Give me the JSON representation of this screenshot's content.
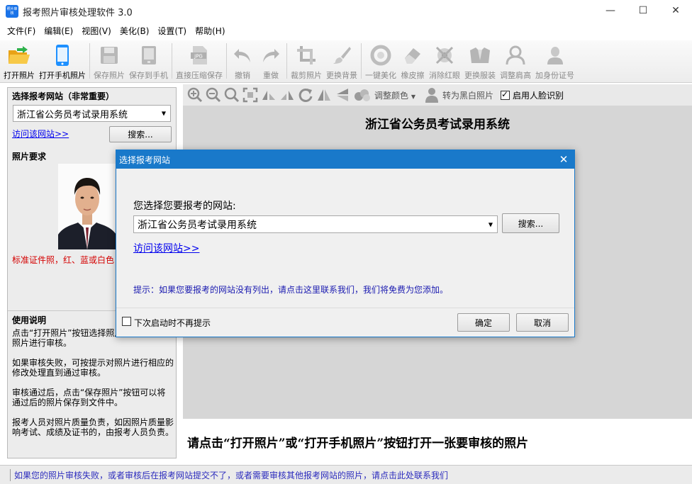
{
  "window": {
    "title": "报考照片审核处理软件 3.0",
    "app_icon_text": "照片审核",
    "minimize": "—",
    "maximize": "☐",
    "close": "✕"
  },
  "menu": [
    "文件(F)",
    "编辑(E)",
    "视图(V)",
    "美化(B)",
    "设置(T)",
    "帮助(H)"
  ],
  "toolbar": [
    {
      "label": "打开照片",
      "icon": "folder-open-icon",
      "enabled": true
    },
    {
      "label": "打开手机照片",
      "icon": "phone-icon",
      "enabled": true
    },
    {
      "label": "保存照片",
      "icon": "save-icon",
      "enabled": false
    },
    {
      "label": "保存到手机",
      "icon": "save-to-phone-icon",
      "enabled": false
    },
    {
      "label": "直接压缩保存",
      "icon": "jpg-compress-icon",
      "enabled": false
    },
    {
      "label": "撤销",
      "icon": "undo-icon",
      "enabled": false
    },
    {
      "label": "重做",
      "icon": "redo-icon",
      "enabled": false
    },
    {
      "label": "裁剪照片",
      "icon": "crop-icon",
      "enabled": false
    },
    {
      "label": "更换背景",
      "icon": "brush-icon",
      "enabled": false
    },
    {
      "label": "一键美化",
      "icon": "beautify-icon",
      "enabled": false
    },
    {
      "label": "橡皮擦",
      "icon": "eraser-icon",
      "enabled": false
    },
    {
      "label": "消除红眼",
      "icon": "red-eye-icon",
      "enabled": false
    },
    {
      "label": "更换服装",
      "icon": "clothes-icon",
      "enabled": false
    },
    {
      "label": "调整肩高",
      "icon": "shoulder-icon",
      "enabled": false
    },
    {
      "label": "加身份证号",
      "icon": "id-person-icon",
      "enabled": false
    }
  ],
  "left_panel": {
    "site_section_title": "选择报考网站（非常重要）",
    "site_selected": "浙江省公务员考试录用系统",
    "visit_link": "访问该网站>>",
    "search_button": "搜索...",
    "requirements_title": "照片要求",
    "requirements_text": "标准证件照，红、蓝或白色",
    "usage_title": "使用说明",
    "usage_paragraphs": [
      "点击“打开照片”按钮选择照片，将自动对照片进行审核。",
      "如果审核失败，可按提示对照片进行相应的修改处理直到通过审核。",
      "审核通过后，点击“保存照片”按钮可以将通过后的照片保存到文件中。",
      "报考人员对照片质量负责，如因照片质量影响考试、成绩及证书的，由报考人员负责。"
    ]
  },
  "canvas_toolbar": {
    "adjust_color": "调整颜色",
    "to_bw": "转为黑白照片",
    "face_detect_label": "启用人脸识别",
    "face_detect_checked": true
  },
  "canvas": {
    "title": "浙江省公务员考试录用系统",
    "bottom_hint": "请点击“打开照片”或“打开手机照片”按钮打开一张要审核的照片"
  },
  "status_bar": {
    "text": "如果您的照片审核失败，或者审核后在报考网站提交不了，或者需要审核其他报考网站的照片，请点击此处联系我们"
  },
  "dialog": {
    "title": "选择报考网站",
    "prompt": "您选择您要报考的网站:",
    "site_selected": "浙江省公务员考试录用系统",
    "search_button": "搜索...",
    "visit_link": "访问该网站>>",
    "tip": "提示：如果您要报考的网站没有列出，请点击这里联系我们，我们将免费为您添加。",
    "dont_show_label": "下次启动时不再提示",
    "dont_show_checked": false,
    "ok_button": "确定",
    "cancel_button": "取消"
  }
}
